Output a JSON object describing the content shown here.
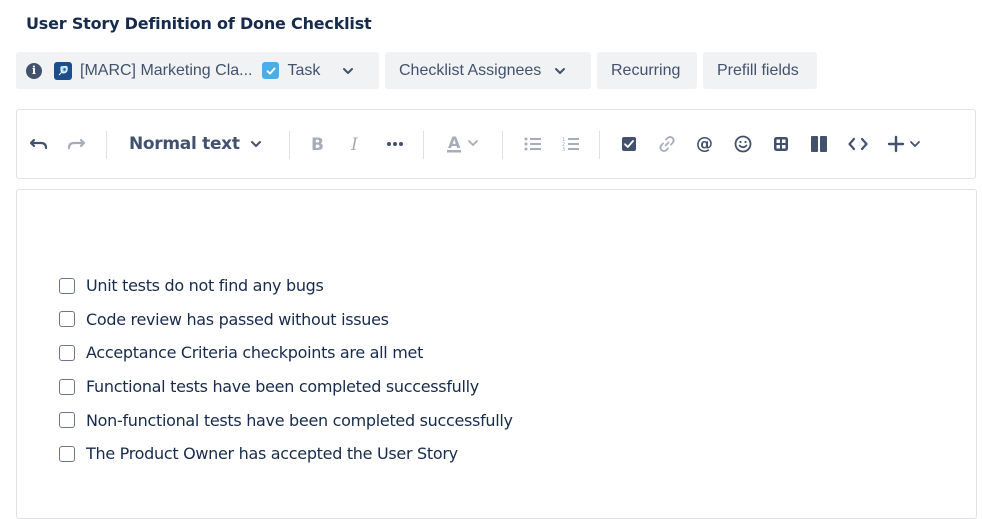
{
  "header": {
    "title": "User Story Definition of Done Checklist"
  },
  "chips": {
    "project_label": "[MARC] Marketing Cla...",
    "issue_type_label": "Task",
    "assignees_label": "Checklist Assignees",
    "recurring_label": "Recurring",
    "prefill_label": "Prefill fields"
  },
  "toolbar": {
    "text_style_label": "Normal text",
    "icons": [
      "undo-icon",
      "redo-icon",
      "bold-icon",
      "italic-icon",
      "more-formatting-icon",
      "text-color-icon",
      "bullet-list-icon",
      "numbered-list-icon",
      "action-item-icon",
      "link-icon",
      "mention-icon",
      "emoji-icon",
      "table-icon",
      "layouts-icon",
      "code-icon",
      "insert-icon"
    ]
  },
  "checklist": {
    "items": [
      {
        "label": "Unit tests do not find any bugs",
        "checked": false
      },
      {
        "label": "Code review has passed without issues",
        "checked": false
      },
      {
        "label": "Acceptance Criteria checkpoints are all met",
        "checked": false
      },
      {
        "label": "Functional tests have been completed successfully",
        "checked": false
      },
      {
        "label": "Non-functional tests have been completed successfully",
        "checked": false
      },
      {
        "label": "The Product Owner has accepted the User Story",
        "checked": false
      }
    ]
  },
  "colors": {
    "accent": "#4bade8",
    "text": "#172b4d",
    "subtle_text": "#42526e",
    "chip_bg": "#f1f2f4",
    "border": "#dfe1e6"
  }
}
